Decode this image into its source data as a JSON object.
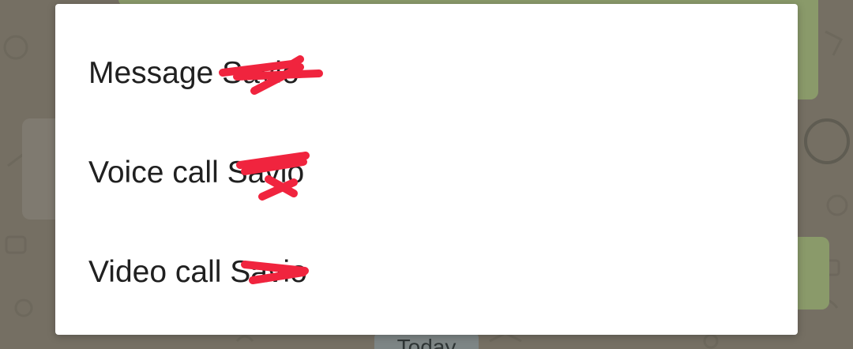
{
  "dialog": {
    "options": [
      {
        "label": "Message Savio"
      },
      {
        "label": "Voice call Savio"
      },
      {
        "label": "Video call Savio"
      }
    ]
  },
  "background": {
    "date_chip": "Today"
  },
  "colors": {
    "dialog_bg": "#ffffff",
    "text": "#202020",
    "redaction": "#f0243e",
    "scrim": "#756f63"
  }
}
